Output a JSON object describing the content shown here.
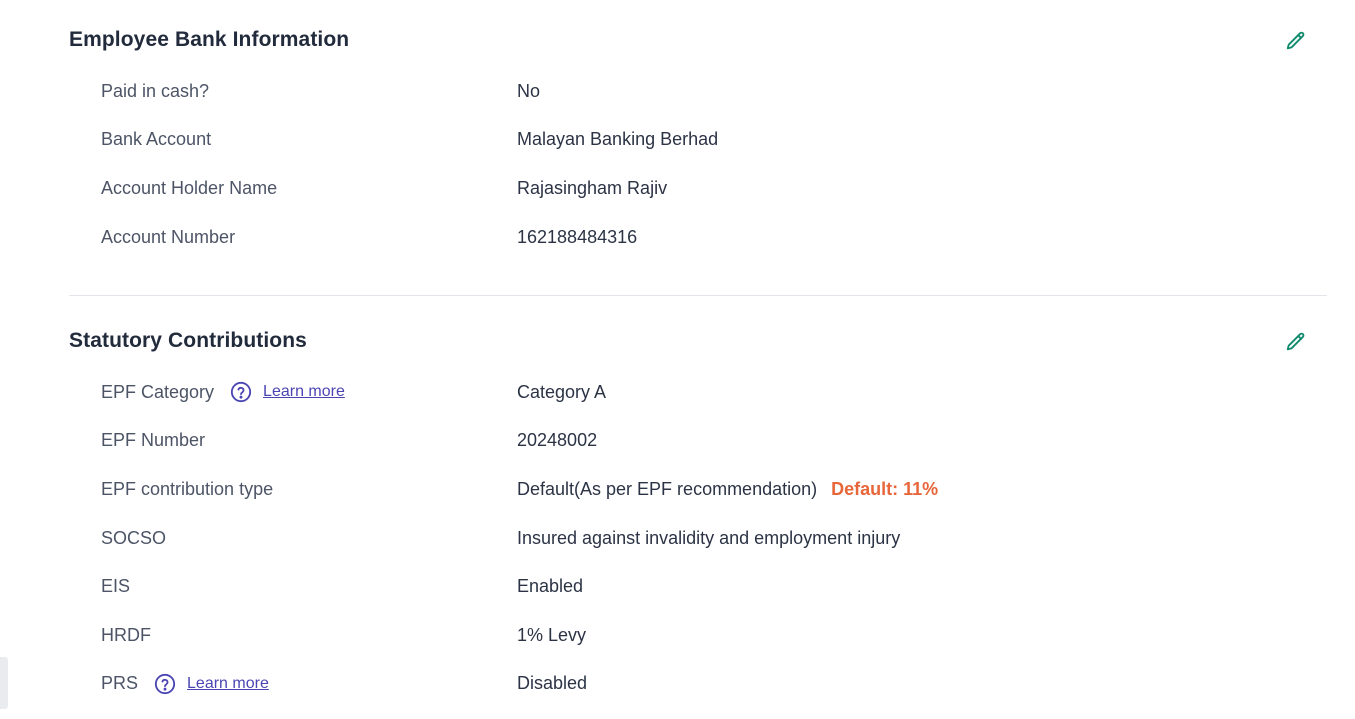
{
  "bank": {
    "title": "Employee Bank Information",
    "rows": [
      {
        "label": "Paid in cash?",
        "value": "No"
      },
      {
        "label": "Bank Account",
        "value": "Malayan Banking Berhad"
      },
      {
        "label": "Account Holder Name",
        "value": "Rajasingham Rajiv"
      },
      {
        "label": "Account Number",
        "value": "162188484316"
      }
    ]
  },
  "statutory": {
    "title": "Statutory Contributions",
    "rows": [
      {
        "label": "EPF Category",
        "value": "Category A",
        "link": "Learn more"
      },
      {
        "label": "EPF Number",
        "value": "20248002"
      },
      {
        "label": "EPF contribution type",
        "value": "Default(As per EPF recommendation)",
        "badge": "Default: 11%"
      },
      {
        "label": "SOCSO",
        "value": "Insured against invalidity and employment injury"
      },
      {
        "label": "EIS",
        "value": "Enabled"
      },
      {
        "label": "HRDF",
        "value": "1% Levy"
      },
      {
        "label": "PRS",
        "value": "Disabled",
        "link": "Learn more"
      }
    ]
  },
  "icons": {
    "edit": "pencil-icon",
    "help": "question-circle-icon"
  },
  "colors": {
    "edit_icon": "#0f8a6c",
    "link": "#4b45b3",
    "badge": "#e7663a"
  }
}
